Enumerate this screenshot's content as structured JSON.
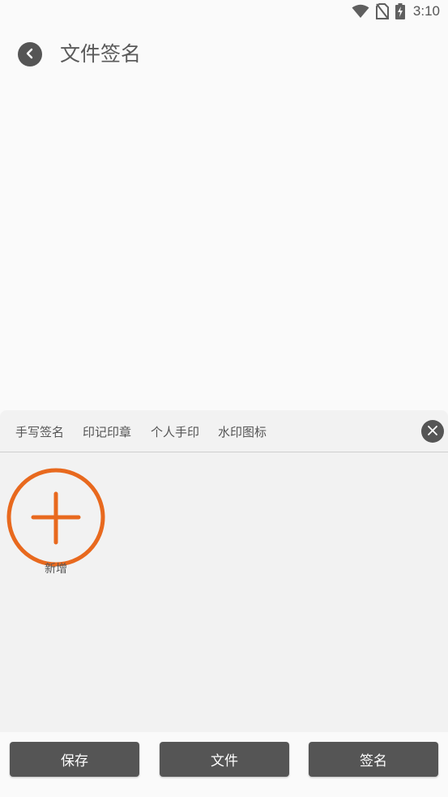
{
  "status_bar": {
    "time": "3:10",
    "icons": [
      "wifi-icon",
      "no-sim-icon",
      "battery-charging-icon"
    ]
  },
  "header": {
    "title": "文件签名",
    "back_icon": "chevron-left-icon"
  },
  "panel": {
    "tabs": [
      {
        "label": "手写签名"
      },
      {
        "label": "印记印章"
      },
      {
        "label": "个人手印"
      },
      {
        "label": "水印图标"
      }
    ],
    "close_icon": "close-icon",
    "add_tile": {
      "label": "新增",
      "icon": "plus-circle-icon"
    }
  },
  "bottom_bar": {
    "save_label": "保存",
    "file_label": "文件",
    "sign_label": "签名"
  },
  "colors": {
    "accent": "#e8691e",
    "button_bg": "#555555",
    "panel_bg": "#f2f2f2",
    "page_bg": "#fafafa"
  }
}
